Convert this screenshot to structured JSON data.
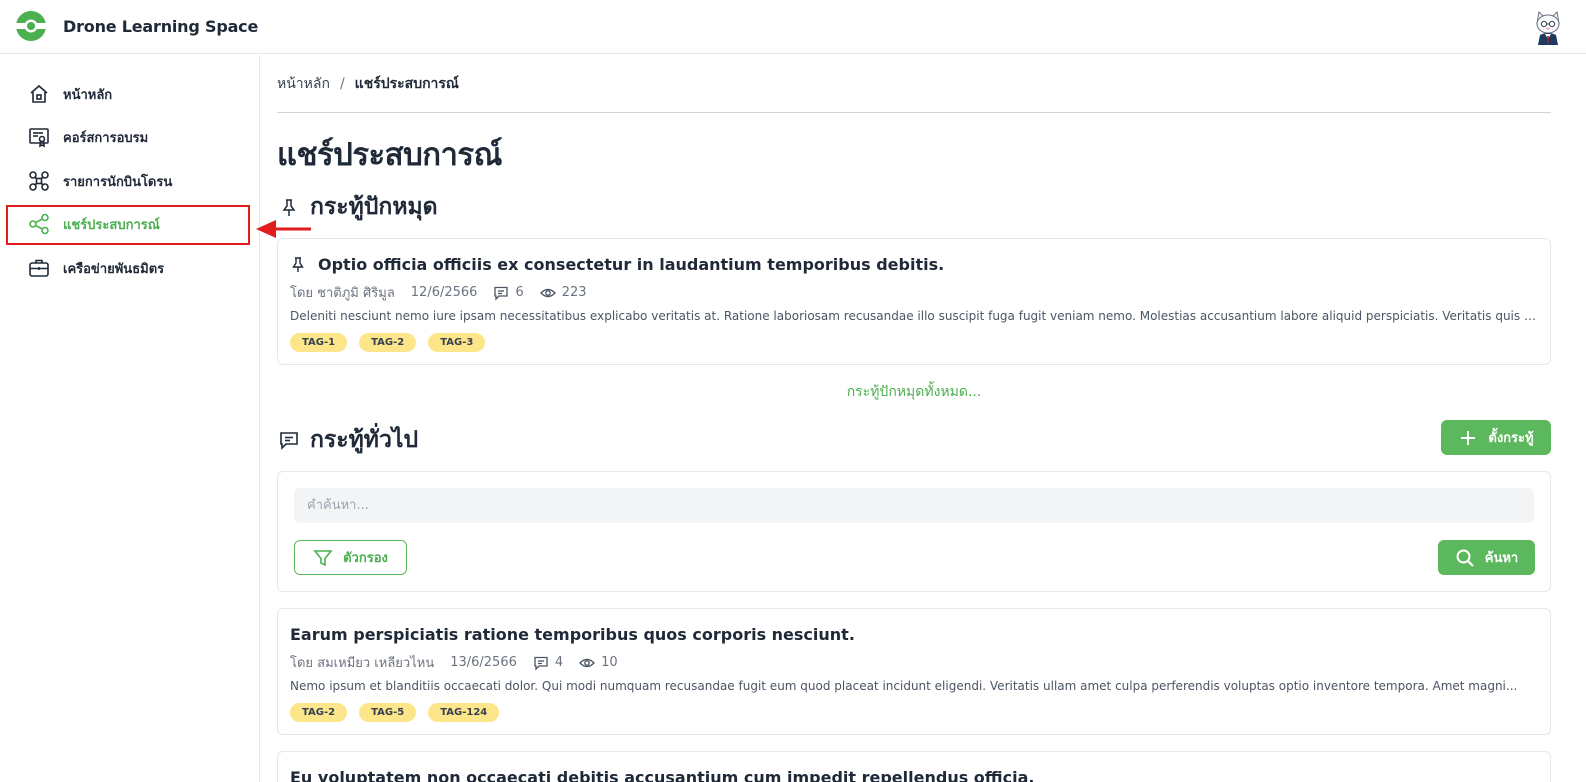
{
  "app": {
    "name": "Drone Learning Space",
    "accent_color": "#4caf50",
    "logo_icon": "drone-eye-logo",
    "avatar_icon": "cat-avatar"
  },
  "sidebar": {
    "items": [
      {
        "label": "หน้าหลัก",
        "icon": "home-icon",
        "active": false
      },
      {
        "label": "คอร์สการอบรม",
        "icon": "certificate-icon",
        "active": false
      },
      {
        "label": "รายการนักบินโดรน",
        "icon": "drone-icon",
        "active": false
      },
      {
        "label": "แชร์ประสบการณ์",
        "icon": "share-icon",
        "active": true
      },
      {
        "label": "เครือข่ายพันธมิตร",
        "icon": "briefcase-icon",
        "active": false
      }
    ]
  },
  "breadcrumb": {
    "home": "หน้าหลัก",
    "separator": "/",
    "current": "แชร์ประสบการณ์"
  },
  "page": {
    "title": "แชร์ประสบการณ์"
  },
  "pinned": {
    "heading": "กระทู้ปักหมุด",
    "see_all": "กระทู้ปักหมุดทั้งหมด...",
    "posts": [
      {
        "title": "Optio officia officiis ex consectetur in laudantium temporibus debitis.",
        "author": "โดย ชาติภูมิ ศิริมูล",
        "date": "12/6/2566",
        "comments": "6",
        "views": "223",
        "excerpt": "Deleniti nesciunt nemo iure ipsam necessitatibus explicabo veritatis at. Ratione laboriosam recusandae illo suscipit fuga fugit veniam nemo. Molestias accusantium labore aliquid perspiciatis. Veritatis quis sunt...",
        "tags": [
          "TAG-1",
          "TAG-2",
          "TAG-3"
        ]
      }
    ]
  },
  "general": {
    "heading": "กระทู้ทั่วไป",
    "new_post_label": "ตั้งกระทู้",
    "search": {
      "placeholder": "คำค้นหา...",
      "value": "",
      "filter_label": "ตัวกรอง",
      "search_label": "ค้นหา"
    },
    "posts": [
      {
        "title": "Earum perspiciatis ratione temporibus quos corporis nesciunt.",
        "author": "โดย สมเหมียว เหลียวไหน",
        "date": "13/6/2566",
        "comments": "4",
        "views": "10",
        "excerpt": "Nemo ipsum et blanditiis occaecati dolor. Qui modi numquam recusandae fugit eum quod placeat incidunt eligendi. Veritatis ullam amet culpa perferendis voluptas optio inventore tempora. Amet magni...",
        "tags": [
          "TAG-2",
          "TAG-5",
          "TAG-124"
        ]
      },
      {
        "title": "Eu voluptatem non occaecati debitis accusantium cum impedit repellendus officia."
      }
    ]
  },
  "tag_color": "#fde68a"
}
